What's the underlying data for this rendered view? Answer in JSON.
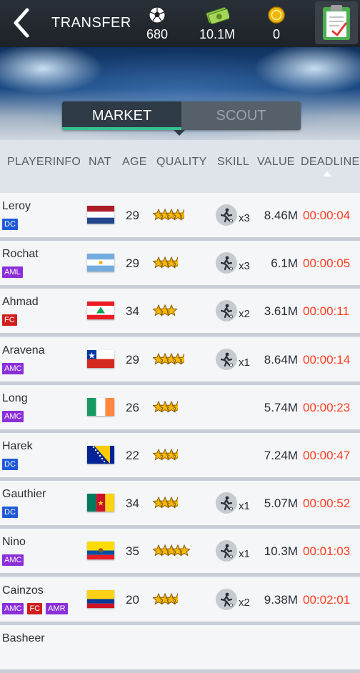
{
  "topbar": {
    "title": "TRANSFER",
    "stats": [
      {
        "icon": "soccer-ball-icon",
        "value": "680"
      },
      {
        "icon": "cash-icon",
        "value": "10.1M"
      },
      {
        "icon": "coin-icon",
        "value": "0"
      }
    ]
  },
  "tabs": [
    {
      "label": "MARKET",
      "active": true
    },
    {
      "label": "SCOUT",
      "active": false
    }
  ],
  "columns": [
    "PLAYERINFO",
    "NAT",
    "AGE",
    "QUALITY",
    "SKILL",
    "VALUE",
    "DEADLINE"
  ],
  "colors": {
    "accent": "#36c08f",
    "deadline": "#ff3d1f",
    "badge_dc": "#1f5bd6",
    "badge_amc": "#8b2fd9",
    "badge_fc": "#d01e1e"
  },
  "players": [
    {
      "name": "Leroy",
      "positions": [
        "DC"
      ],
      "nat": "netherlands",
      "age": "29",
      "stars": 4.5,
      "skill": "x3",
      "value": "8.46M",
      "deadline": "00:00:04"
    },
    {
      "name": "Rochat",
      "positions": [
        "AML"
      ],
      "nat": "argentina",
      "age": "29",
      "stars": 3.5,
      "skill": "x3",
      "value": "6.1M",
      "deadline": "00:00:05"
    },
    {
      "name": "Ahmad",
      "positions": [
        "FC"
      ],
      "nat": "lebanon",
      "age": "34",
      "stars": 3,
      "skill": "x2",
      "value": "3.61M",
      "deadline": "00:00:11"
    },
    {
      "name": "Aravena",
      "positions": [
        "AMC"
      ],
      "nat": "chile",
      "age": "29",
      "stars": 4.5,
      "skill": "x1",
      "value": "8.64M",
      "deadline": "00:00:14"
    },
    {
      "name": "Long",
      "positions": [
        "AMC"
      ],
      "nat": "ireland",
      "age": "26",
      "stars": 3.5,
      "skill": "",
      "value": "5.74M",
      "deadline": "00:00:23"
    },
    {
      "name": "Harek",
      "positions": [
        "DC"
      ],
      "nat": "bosnia",
      "age": "22",
      "stars": 3.5,
      "skill": "",
      "value": "7.24M",
      "deadline": "00:00:47"
    },
    {
      "name": "Gauthier",
      "positions": [
        "DC"
      ],
      "nat": "cameroon",
      "age": "34",
      "stars": 3.5,
      "skill": "x1",
      "value": "5.07M",
      "deadline": "00:00:52"
    },
    {
      "name": "Nino",
      "positions": [
        "AMC"
      ],
      "nat": "ecuador",
      "age": "35",
      "stars": 5,
      "skill": "x1",
      "value": "10.3M",
      "deadline": "00:01:03"
    },
    {
      "name": "Cainzos",
      "positions": [
        "AMC",
        "FC",
        "AMR"
      ],
      "nat": "colombia",
      "age": "20",
      "stars": 3.5,
      "skill": "x2",
      "value": "9.38M",
      "deadline": "00:02:01"
    },
    {
      "name": "Basheer",
      "positions": [],
      "nat": "",
      "age": "",
      "stars": 0,
      "skill": "",
      "value": "",
      "deadline": ""
    }
  ]
}
